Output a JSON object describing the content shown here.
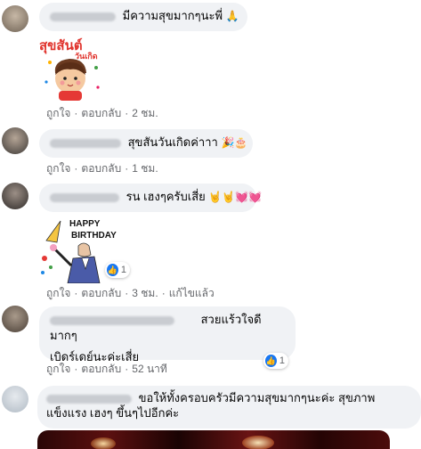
{
  "comments": [
    {
      "text": "มีความสุขมากๆนะพี่",
      "emoji": "🙏"
    },
    {
      "sticker_text": "สุขสันต์",
      "sticker_sub": "วันเกิด",
      "like": "ถูกใจ",
      "reply": "ตอบกลับ",
      "time": "2 ชม."
    },
    {
      "text": "สุขสันวันเกิดค่าาา",
      "emoji": "🎉🎂",
      "like": "ถูกใจ",
      "reply": "ตอบกลับ",
      "time": "1 ชม."
    },
    {
      "text": "รน เฮงๆครับเสี่ย",
      "emoji": "🤘🤘💓💓"
    },
    {
      "sticker_line1": "HAPPY",
      "sticker_line2": "BIRTHDAY",
      "reaction_count": "1",
      "like": "ถูกใจ",
      "reply": "ตอบกลับ",
      "time": "3 ชม.",
      "edited": "แก้ไขแล้ว"
    },
    {
      "text_line1": "สวยแร้วใจดีมากๆ",
      "text_line2": "เบิดร์เดย์นะค่ะเสี่ย",
      "reaction_count": "1",
      "like": "ถูกใจ",
      "reply": "ตอบกลับ",
      "time": "52 นาที"
    },
    {
      "text_line1": "ขอให้ทั้งครอบครัวมีความสุขมากๆนะค่ะ สุขภาพ",
      "text_line2": "แข็งแรง เฮงๆ ขึ้นๆไปอีกค่ะ"
    }
  ],
  "colors": {
    "bubble": "#f0f2f5",
    "meta": "#65676b",
    "like_blue": "#1877f2"
  }
}
